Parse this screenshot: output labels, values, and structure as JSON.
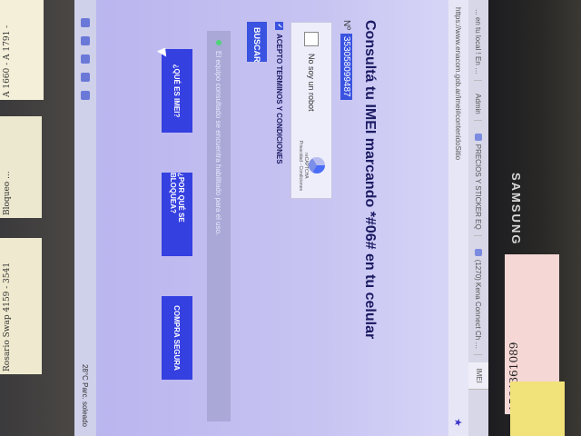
{
  "browser": {
    "tabs": [
      "... en tu local ! En …",
      "Admin",
      "PRECIOS Y STICKER EQ",
      "(1270) Kena Connect Ch …",
      "IMEI"
    ],
    "url": "https://www.enacom.gob.ar/imei#contenidoSitio"
  },
  "page": {
    "title": "Consultá tu IMEI marcando *#06# en tu celular",
    "imei_label": "Nº",
    "imei_value": "353058099487",
    "captcha_label": "No soy un robot",
    "captcha_brand": "reCAPTCHA",
    "captcha_links": "Privacidad - Condiciones",
    "terms_label": "ACEPTO TERMINOS Y CONDICIONES",
    "search_button": "BUSCAR",
    "status_text": "El equipo consultado se encuentra habilitado para el uso.",
    "buttons": [
      "¿QUÉ ES IMEI?",
      "¿POR QUÉ SE BLOQUEA?",
      "COMPRA SEGURA"
    ]
  },
  "taskbar": {
    "weather": "28°C Parc. soleado"
  },
  "environment": {
    "monitor_brand": "SAMSUNG",
    "note1": "A 1660 - A 1791 -",
    "note2": "Bloqueo ...",
    "note3": "Rosario Swap 4159 - 3541",
    "note4": "1564361089"
  },
  "colors": {
    "accent": "#3a53e0",
    "title": "#1b1a62"
  }
}
